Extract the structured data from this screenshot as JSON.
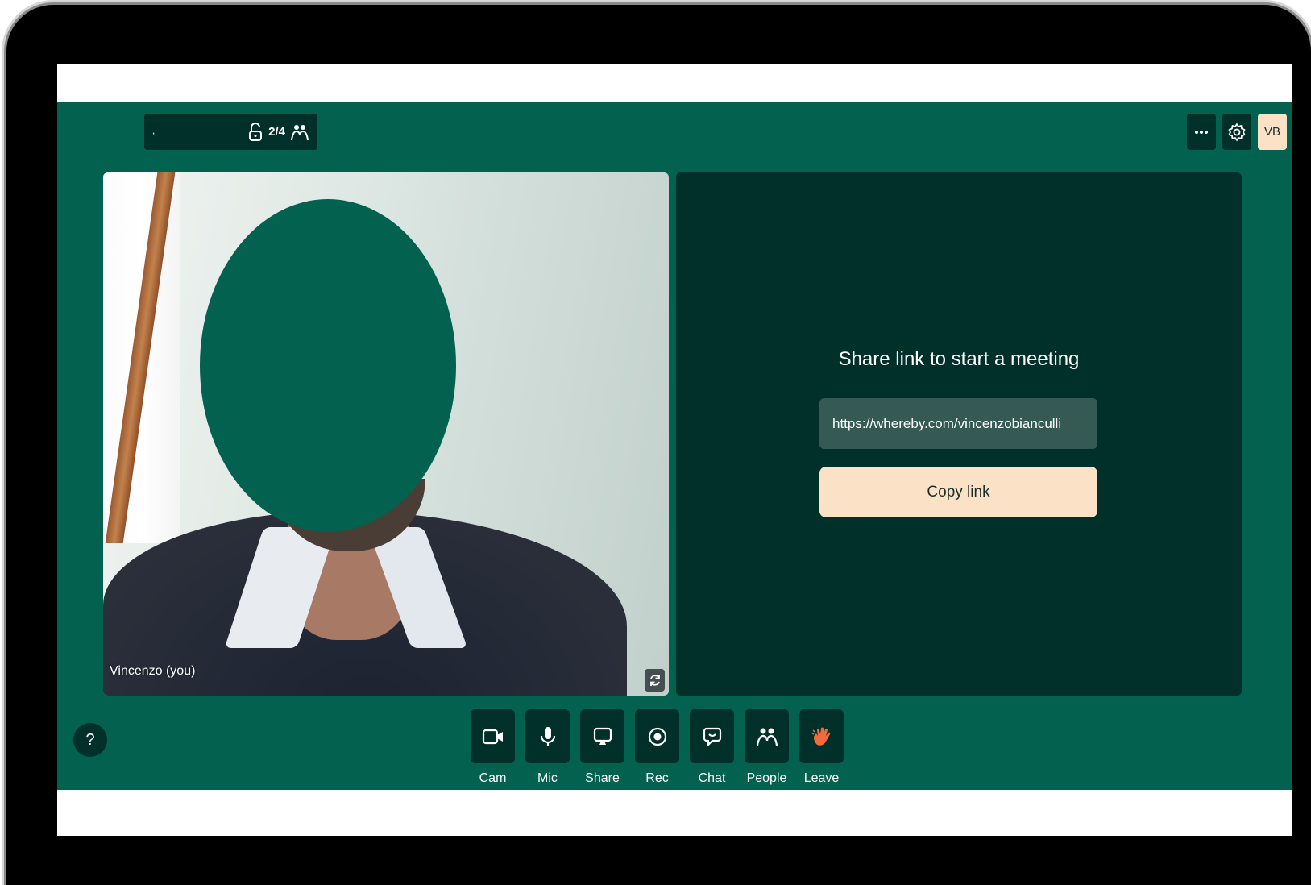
{
  "topbar": {
    "room_name": "‚",
    "participant_count": "2/4",
    "lock_icon": "unlock-icon",
    "people_icon": "people-icon",
    "more_icon": "more-dots-icon",
    "settings_icon": "gear-icon",
    "avatar_initials": "VB"
  },
  "video": {
    "self_name": "Vincenzo (you)",
    "flip_icon": "camera-flip-icon"
  },
  "share": {
    "title": "Share link to start a meeting",
    "link_value": "https://whereby.com/vincenzobianculli",
    "copy_label": "Copy link"
  },
  "help": {
    "label": "?"
  },
  "controls": [
    {
      "label": "Cam",
      "icon": "camera-icon"
    },
    {
      "label": "Mic",
      "icon": "microphone-icon"
    },
    {
      "label": "Share",
      "icon": "screen-share-icon"
    },
    {
      "label": "Rec",
      "icon": "record-icon"
    },
    {
      "label": "Chat",
      "icon": "chat-icon"
    },
    {
      "label": "People",
      "icon": "people-icon"
    },
    {
      "label": "Leave",
      "icon": "wave-hand-icon"
    }
  ],
  "colors": {
    "app_bg": "#02614f",
    "panel_dark": "#003029",
    "accent_cream": "#fbe2c6",
    "leave_orange": "#f26b3a"
  }
}
